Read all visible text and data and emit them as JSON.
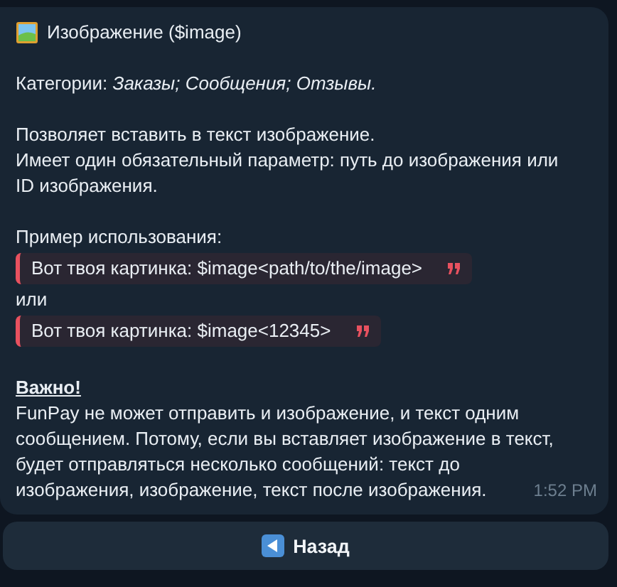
{
  "message": {
    "title": "Изображение ($image)",
    "categories": "Категории: *Заказы; Сообщения; Отзывы.*",
    "description": [
      "Позволяет вставить в текст изображение.",
      "Имеет один обязательный параметр: путь до изображения или",
      "ID изображения."
    ],
    "example_label": "Пример использования:",
    "examples": [
      {
        "kind": "quote",
        "text": "Вот твоя картинка: $image<path/to/the/image>"
      },
      {
        "kind": "separator",
        "text": "или"
      },
      {
        "kind": "quote",
        "text": "Вот твоя картинка: $image<12345>"
      }
    ],
    "important_heading": "Важно!",
    "important_text": [
      "FunPay не может отправить и изображение, и текст одним",
      "сообщением. Потому, если вы вставляет изображение в текст,",
      "будет отправляться несколько сообщений: текст до",
      "изображения, изображение, текст после изображения."
    ],
    "time": "1:52 PM"
  },
  "buttons": [
    {
      "label": "Назад"
    }
  ]
}
